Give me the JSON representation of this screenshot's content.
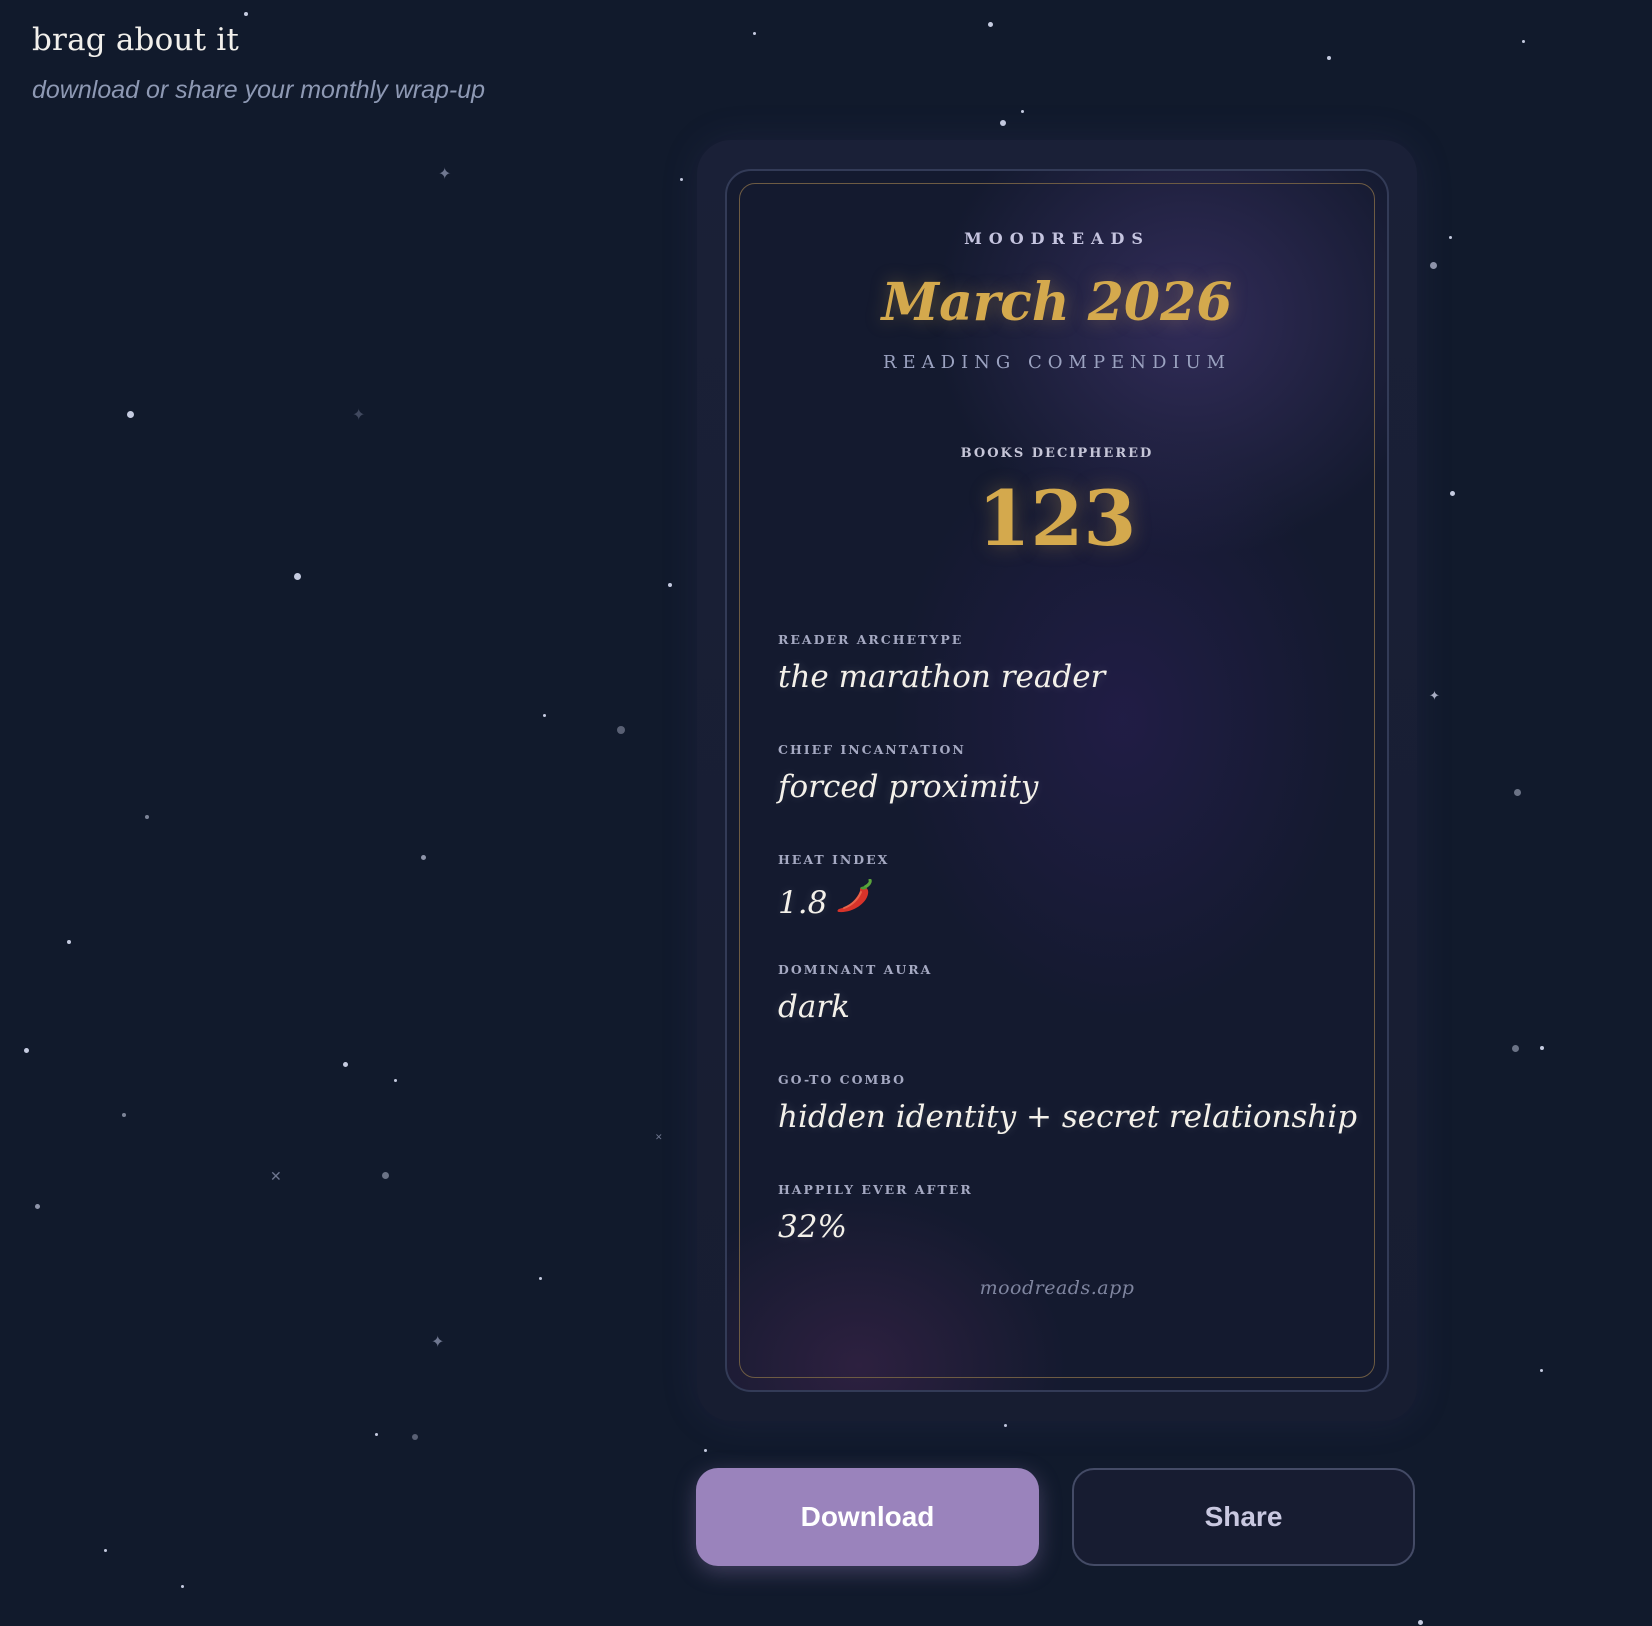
{
  "header": {
    "title": "brag about it",
    "subtitle": "download or share your monthly wrap-up"
  },
  "card": {
    "brand": "MOODREADS",
    "month": "March 2026",
    "subtitle": "READING COMPENDIUM",
    "books_label": "BOOKS DECIPHERED",
    "books_count": "123",
    "stats": [
      {
        "label": "READER ARCHETYPE",
        "value": "the marathon reader"
      },
      {
        "label": "CHIEF INCANTATION",
        "value": "forced proximity"
      },
      {
        "label": "HEAT INDEX",
        "value": "1.8",
        "icon": "chili-pepper-icon"
      },
      {
        "label": "DOMINANT AURA",
        "value": "dark"
      },
      {
        "label": "GO-TO COMBO",
        "value": "hidden identity + secret relationship"
      },
      {
        "label": "HAPPILY EVER AFTER",
        "value": "32%"
      }
    ],
    "footer": "moodreads.app"
  },
  "actions": {
    "download_label": "Download",
    "share_label": "Share"
  },
  "colors": {
    "background": "#111a2c",
    "gold_accent": "#d4a94d",
    "download_button": "#9a83bc"
  }
}
